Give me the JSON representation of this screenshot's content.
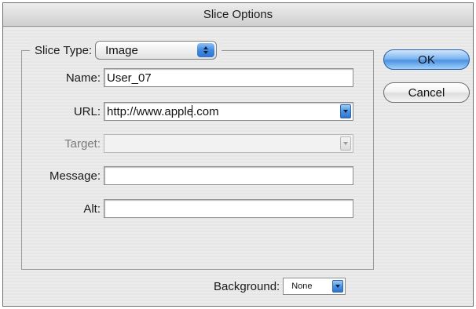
{
  "window": {
    "title": "Slice Options"
  },
  "slice_type": {
    "label": "Slice Type:",
    "value": "Image"
  },
  "fields": {
    "name": {
      "label": "Name:",
      "value": "User_07"
    },
    "url": {
      "label": "URL:",
      "value": "http://www.apple.com"
    },
    "target": {
      "label": "Target:",
      "value": ""
    },
    "message": {
      "label": "Message:",
      "value": ""
    },
    "alt": {
      "label": "Alt:",
      "value": ""
    }
  },
  "buttons": {
    "ok": "OK",
    "cancel": "Cancel"
  },
  "background": {
    "label": "Background:",
    "value": "None"
  },
  "colors": {
    "accent": "#4d93e2",
    "dialog_bg": "#ececec"
  },
  "icons": {
    "slice_type_arrows": "up-down-arrows-icon",
    "dropdown": "chevron-down-icon"
  }
}
